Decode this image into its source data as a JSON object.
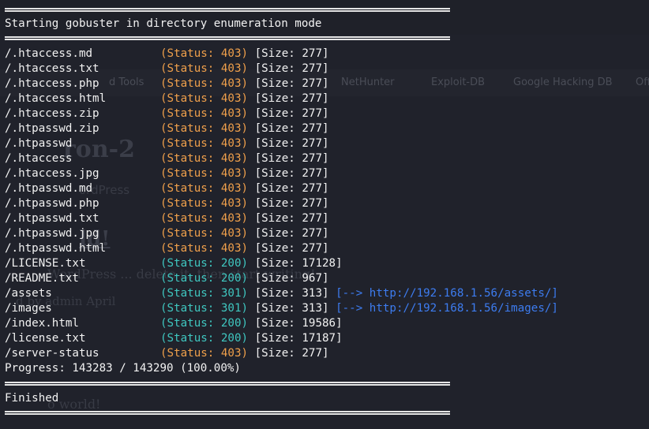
{
  "background": {
    "bookmarks": [
      "d Tools",
      "NetHunter",
      "Exploit-DB",
      "Google Hacking DB",
      "OffSec"
    ],
    "site_title": "ron-2",
    "tagline": "ordPress",
    "post_title": "ld!",
    "body_text": "WordPress ... delete it, then start writing!",
    "post_meta": "d by admin  April",
    "footer_text": "o world!"
  },
  "terminal": {
    "header": "Starting gobuster in directory enumeration mode",
    "status_prefix": "(Status: ",
    "status_suffix": ")",
    "size_prefix": "[Size: ",
    "size_suffix": "]",
    "arrow": "[-->",
    "results": [
      {
        "path": "/.htaccess.md",
        "status": "403",
        "size": "277",
        "redirect": ""
      },
      {
        "path": "/.htaccess.txt",
        "status": "403",
        "size": "277",
        "redirect": ""
      },
      {
        "path": "/.htaccess.php",
        "status": "403",
        "size": "277",
        "redirect": ""
      },
      {
        "path": "/.htaccess.html",
        "status": "403",
        "size": "277",
        "redirect": ""
      },
      {
        "path": "/.htaccess.zip",
        "status": "403",
        "size": "277",
        "redirect": ""
      },
      {
        "path": "/.htpasswd.zip",
        "status": "403",
        "size": "277",
        "redirect": ""
      },
      {
        "path": "/.htpasswd",
        "status": "403",
        "size": "277",
        "redirect": ""
      },
      {
        "path": "/.htaccess",
        "status": "403",
        "size": "277",
        "redirect": ""
      },
      {
        "path": "/.htaccess.jpg",
        "status": "403",
        "size": "277",
        "redirect": ""
      },
      {
        "path": "/.htpasswd.md",
        "status": "403",
        "size": "277",
        "redirect": ""
      },
      {
        "path": "/.htpasswd.php",
        "status": "403",
        "size": "277",
        "redirect": ""
      },
      {
        "path": "/.htpasswd.txt",
        "status": "403",
        "size": "277",
        "redirect": ""
      },
      {
        "path": "/.htpasswd.jpg",
        "status": "403",
        "size": "277",
        "redirect": ""
      },
      {
        "path": "/.htpasswd.html",
        "status": "403",
        "size": "277",
        "redirect": ""
      },
      {
        "path": "/LICENSE.txt",
        "status": "200",
        "size": "17128",
        "redirect": ""
      },
      {
        "path": "/README.txt",
        "status": "200",
        "size": "967",
        "redirect": ""
      },
      {
        "path": "/assets",
        "status": "301",
        "size": "313",
        "redirect": "http://192.168.1.56/assets/"
      },
      {
        "path": "/images",
        "status": "301",
        "size": "313",
        "redirect": "http://192.168.1.56/images/"
      },
      {
        "path": "/index.html",
        "status": "200",
        "size": "19586",
        "redirect": ""
      },
      {
        "path": "/license.txt",
        "status": "200",
        "size": "17187",
        "redirect": ""
      },
      {
        "path": "/server-status",
        "status": "403",
        "size": "277",
        "redirect": ""
      }
    ],
    "progress": "Progress: 143283 / 143290 (100.00%)",
    "finished": "Finished"
  },
  "colors": {
    "status_403": "#f0a04b",
    "status_200": "#3fc7c0",
    "status_301": "#3fc7c0",
    "redirect": "#3d7cf0",
    "text": "#f2f2f2",
    "background": "#20222b"
  }
}
